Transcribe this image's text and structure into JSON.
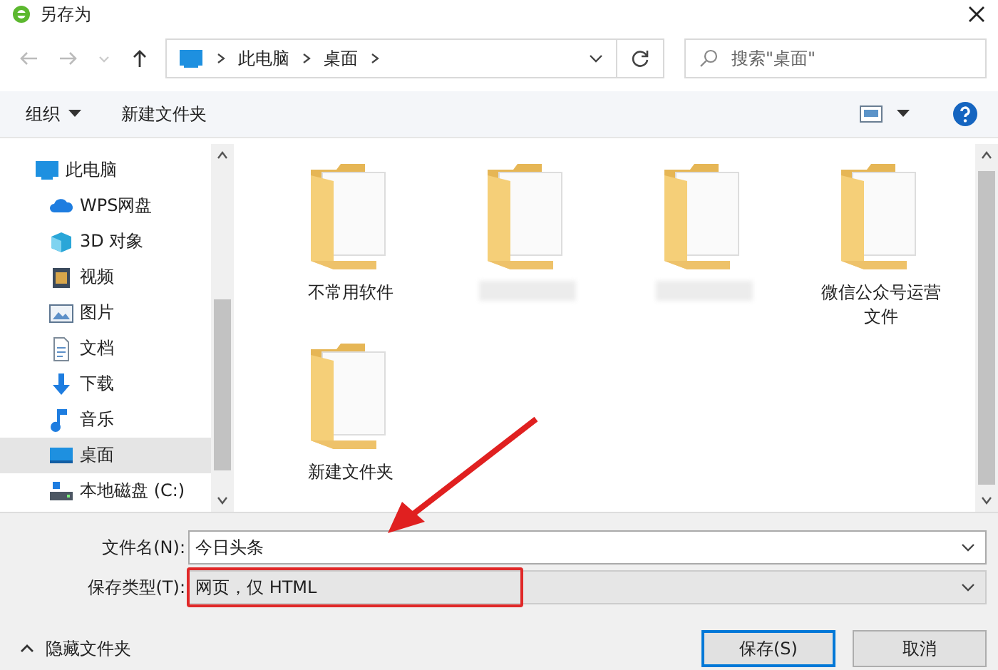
{
  "window": {
    "title": "另存为"
  },
  "address_bar": {
    "path": [
      "此电脑",
      "桌面"
    ]
  },
  "search": {
    "placeholder": "搜索\"桌面\""
  },
  "toolbar": {
    "items": [
      "组织",
      "新建文件夹"
    ]
  },
  "sidebar": {
    "items": [
      {
        "label": "此电脑",
        "kind": "pc",
        "selected": false,
        "children": [
          {
            "label": "WPS网盘",
            "kind": "cloud",
            "selected": false
          },
          {
            "label": "3D 对象",
            "kind": "cube",
            "selected": false
          },
          {
            "label": "视频",
            "kind": "video",
            "selected": false
          },
          {
            "label": "图片",
            "kind": "picture",
            "selected": false
          },
          {
            "label": "文档",
            "kind": "doc",
            "selected": false
          },
          {
            "label": "下载",
            "kind": "download",
            "selected": false
          },
          {
            "label": "音乐",
            "kind": "music",
            "selected": false
          },
          {
            "label": "桌面",
            "kind": "desktop",
            "selected": true
          },
          {
            "label": "本地磁盘 (C:)",
            "kind": "drive",
            "selected": false
          }
        ]
      }
    ]
  },
  "files": [
    {
      "label": "不常用软件",
      "blurred": false
    },
    {
      "blurred": true
    },
    {
      "blurred": true
    },
    {
      "label": "微信公众号运营文件",
      "blurred": false
    },
    {
      "label": "新建文件夹",
      "blurred": false
    }
  ],
  "form": {
    "filename_label": "文件名(N):",
    "filename": "今日头条",
    "type_label": "保存类型(T):",
    "type": "网页，仅 HTML"
  },
  "hide_folders": "隐藏文件夹",
  "buttons": [
    "保存(S)",
    "取消"
  ]
}
